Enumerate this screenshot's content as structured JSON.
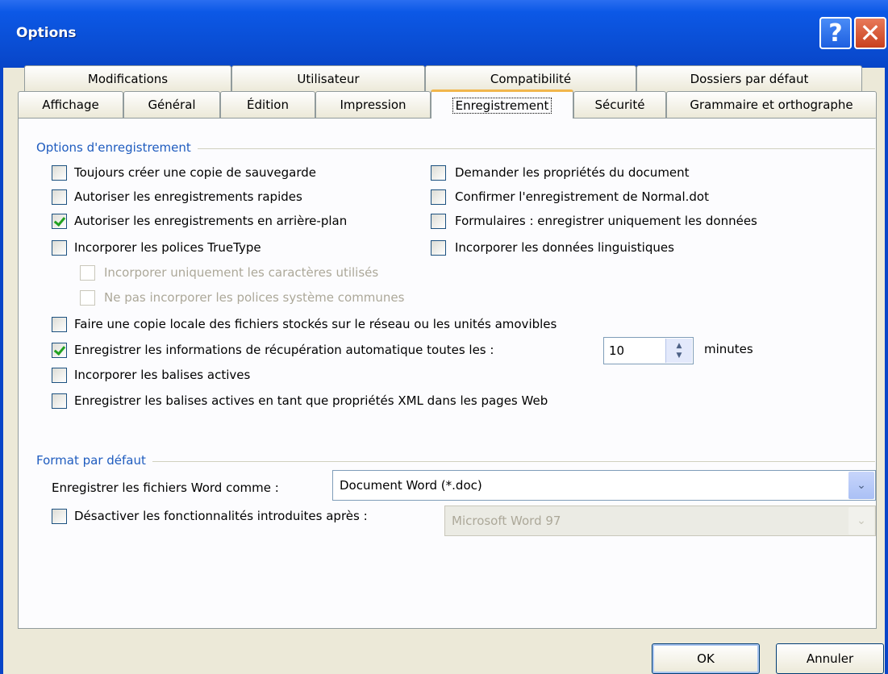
{
  "window": {
    "title": "Options",
    "help_icon": "question-mark-icon",
    "close_icon": "close-x-icon"
  },
  "tabs_row1": [
    "Modifications",
    "Utilisateur",
    "Compatibilité",
    "Dossiers par défaut"
  ],
  "tabs_row2": [
    "Affichage",
    "Général",
    "Édition",
    "Impression",
    "Enregistrement",
    "Sécurité",
    "Grammaire et orthographe"
  ],
  "active_tab": "Enregistrement",
  "save_options": {
    "title": "Options d'enregistrement",
    "items": [
      {
        "label": "Toujours créer une copie de sauvegarde",
        "checked": false
      },
      {
        "label": "Autoriser les enregistrements rapides",
        "checked": false
      },
      {
        "label": "Autoriser les enregistrements en arrière-plan",
        "checked": true
      },
      {
        "label": "Incorporer les polices TrueType",
        "checked": false
      },
      {
        "label": "Incorporer uniquement les caractères utilisés",
        "checked": false,
        "disabled": true
      },
      {
        "label": "Ne pas incorporer les polices système communes",
        "checked": false,
        "disabled": true
      },
      {
        "label": "Faire une copie locale des fichiers stockés sur le réseau ou les unités amovibles",
        "checked": false
      },
      {
        "label": "Enregistrer les informations de récupération automatique toutes les :",
        "checked": true
      },
      {
        "label": "Incorporer les balises actives",
        "checked": false
      },
      {
        "label": "Enregistrer les balises actives en tant que propriétés XML dans les pages Web",
        "checked": false
      }
    ],
    "right_items": [
      {
        "label": "Demander les propriétés du document",
        "checked": false
      },
      {
        "label": "Confirmer l'enregistrement de Normal.dot",
        "checked": false
      },
      {
        "label": "Formulaires : enregistrer uniquement les données",
        "checked": false
      },
      {
        "label": "Incorporer les données linguistiques",
        "checked": false
      }
    ],
    "autorecover_value": "10",
    "autorecover_unit": "minutes"
  },
  "default_format": {
    "title": "Format par défaut",
    "save_as_label": "Enregistrer les fichiers Word comme :",
    "save_as_value": "Document Word (*.doc)",
    "disable_features_label": "Désactiver les fonctionnalités introduites après :",
    "disable_features_checked": false,
    "disable_features_value": "Microsoft Word 97"
  },
  "buttons": {
    "ok": "OK",
    "cancel": "Annuler"
  }
}
